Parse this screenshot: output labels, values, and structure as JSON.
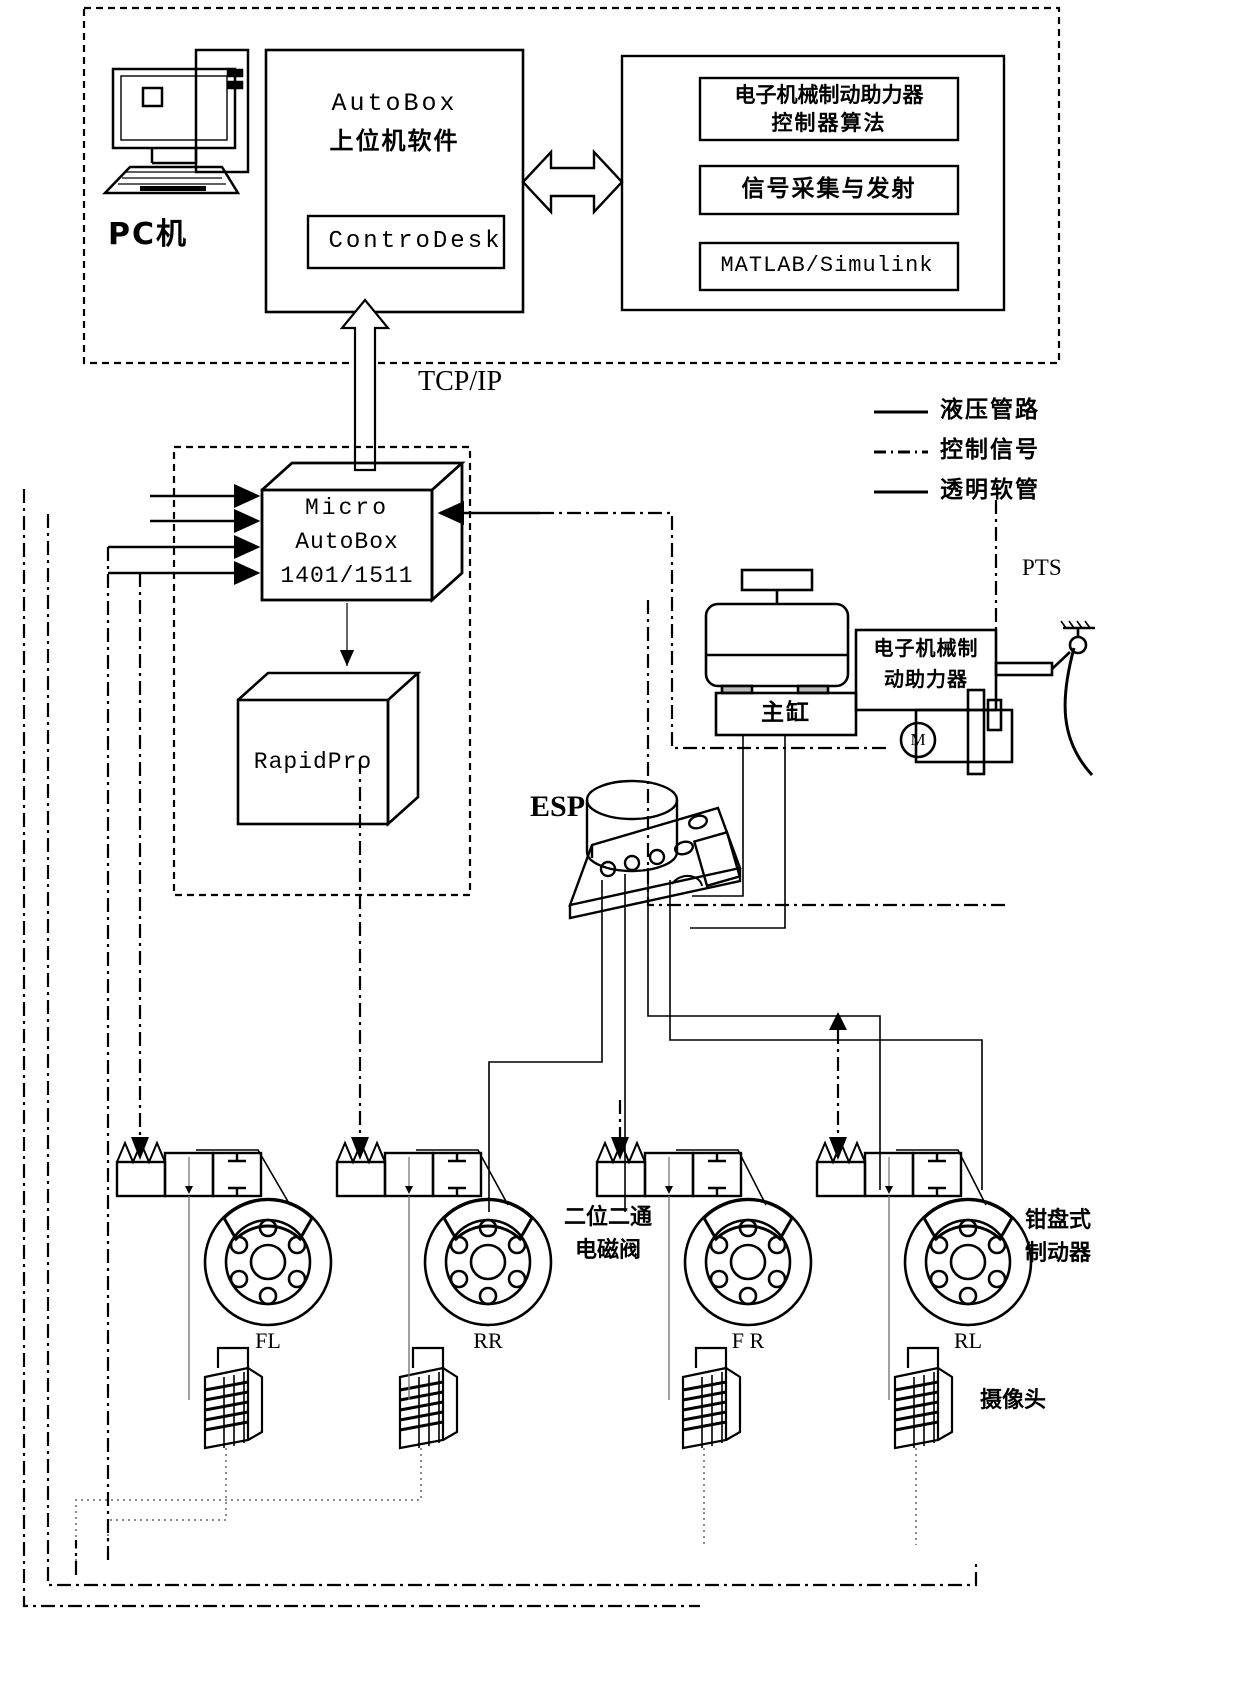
{
  "diagram": {
    "title_text": "",
    "top_dashed_panel": {
      "name": "PC / AutoBox host panel",
      "pc_label": "PC机",
      "autobox_box": {
        "line1": "AutoBox",
        "line2": "上位机软件",
        "inner_box": "ControDesk"
      },
      "right_panel_items": [
        "电子机械制动助力器\n控制器算法",
        "信号采集与发射",
        "MATLAB/Simulink"
      ],
      "right_panel_item_1_line1": "电子机械制动助力器",
      "right_panel_item_1_line2": "控制器算法",
      "right_panel_item_2": "信号采集与发射",
      "right_panel_item_3": "MATLAB/Simulink"
    },
    "tcp_label": "TCP/IP",
    "legend": {
      "items": [
        {
          "style": "solid",
          "label": "液压管路"
        },
        {
          "style": "dashdot",
          "label": "控制信号"
        },
        {
          "style": "solid",
          "label": "透明软管"
        }
      ]
    },
    "hardware": {
      "micro_autobox": {
        "line1": "Micro",
        "line2": "AutoBox",
        "line3": "1401/1511"
      },
      "rapidpro": "RapidPro",
      "esp_label": "ESP",
      "master_cylinder": "主缸",
      "booster_line1": "电子机械制",
      "booster_line2": "动助力器",
      "motor_symbol": "M",
      "pts_label": "PTS"
    },
    "bottom": {
      "valve_label_line1": "二位二通",
      "valve_label_line2": "电磁阀",
      "caliper_label_line1": "钳盘式",
      "caliper_label_line2": "制动器",
      "camera_label": "摄像头",
      "wheels": [
        "FL",
        "RR",
        "F R",
        "RL"
      ]
    },
    "colors": {
      "stroke": "#000000",
      "background": "#ffffff"
    }
  }
}
